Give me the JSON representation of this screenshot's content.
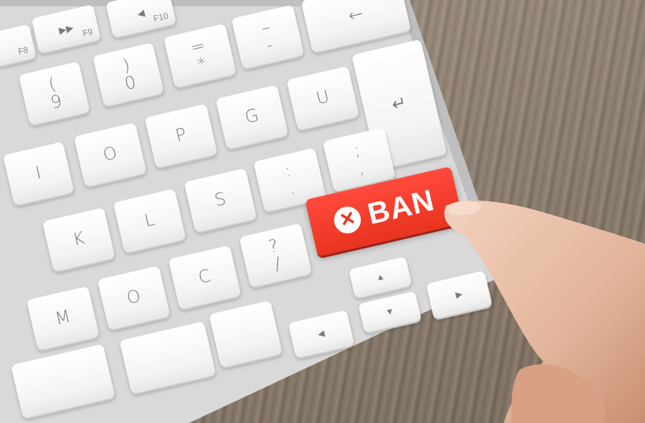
{
  "scene": {
    "key_ban": {
      "label": "BAN",
      "icon": "close-circle-icon",
      "color": "#e8331f"
    },
    "keys": [
      {
        "id": "f8",
        "legend": "",
        "sub": "F8"
      },
      {
        "id": "f9",
        "legend": "▶▶",
        "sub": "F9"
      },
      {
        "id": "f10",
        "legend": "◀",
        "sub": "F10"
      },
      {
        "id": "k9",
        "legend": "(\n9"
      },
      {
        "id": "k0",
        "legend": ")\n0"
      },
      {
        "id": "equals",
        "legend": "=\n*"
      },
      {
        "id": "minus",
        "legend": "–\n-"
      },
      {
        "id": "backspace",
        "legend": "←"
      },
      {
        "id": "enter",
        "legend": "↵"
      },
      {
        "id": "o",
        "legend": "O"
      },
      {
        "id": "p",
        "legend": "P"
      },
      {
        "id": "g",
        "legend": "G"
      },
      {
        "id": "u",
        "legend": "U"
      },
      {
        "id": "i",
        "legend": "I"
      },
      {
        "id": "l",
        "legend": "L"
      },
      {
        "id": "s",
        "legend": "S"
      },
      {
        "id": "colon",
        "legend": ":\n."
      },
      {
        "id": "semicolon",
        "legend": ";\n,"
      },
      {
        "id": "k",
        "legend": "K"
      },
      {
        "id": "question",
        "legend": "?\n/"
      },
      {
        "id": "c",
        "legend": "C"
      },
      {
        "id": "m",
        "legend": "M"
      },
      {
        "id": "o2",
        "legend": "O"
      },
      {
        "id": "up",
        "legend": "▲"
      },
      {
        "id": "down",
        "legend": "▼"
      },
      {
        "id": "left",
        "legend": "◀"
      },
      {
        "id": "right",
        "legend": "▶"
      }
    ]
  }
}
